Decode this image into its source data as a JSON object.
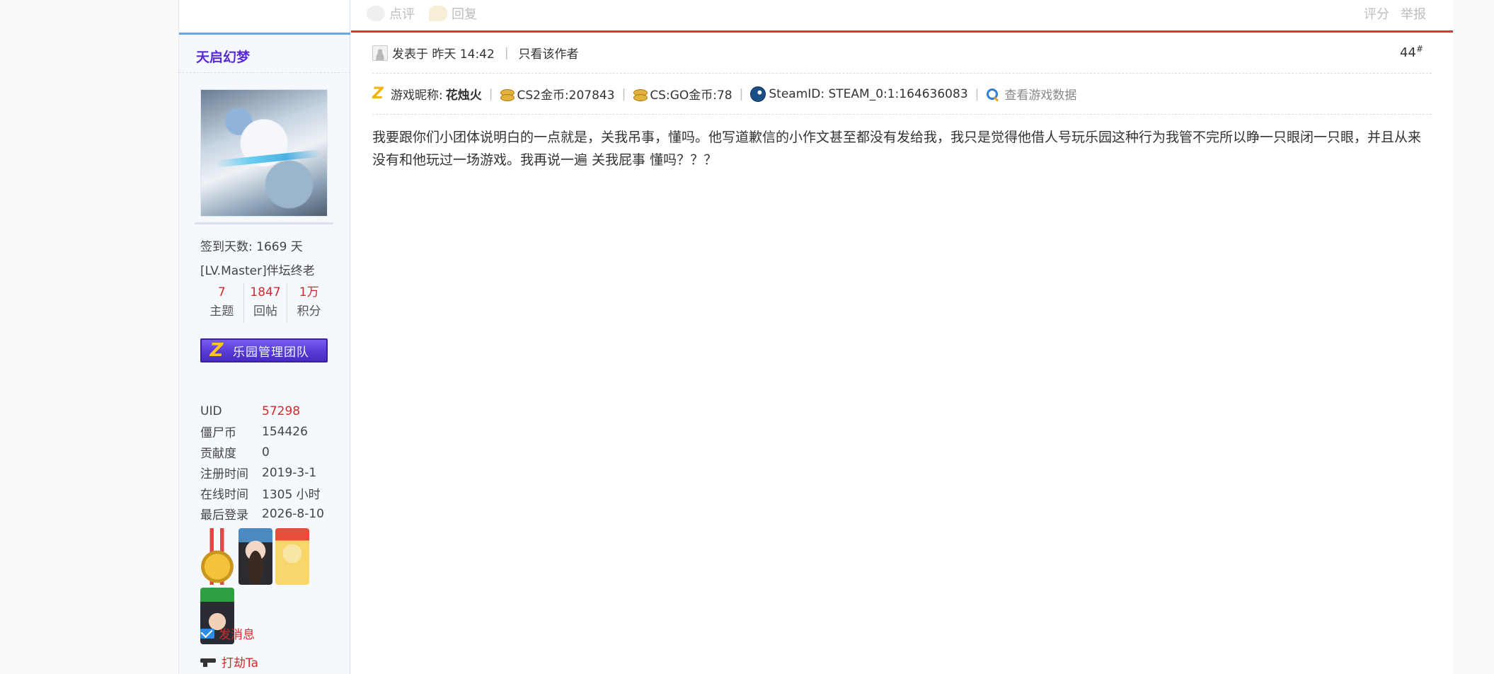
{
  "prev_post": {
    "comment_label": "点评",
    "reply_label": "回复",
    "rate_label": "评分",
    "report_label": "举报"
  },
  "author": {
    "name": "天启幻梦",
    "checkin": "签到天数: 1669 天",
    "level": "[LV.Master]伴坛终老",
    "stats": [
      {
        "num": "7",
        "label": "主题"
      },
      {
        "num": "1847",
        "label": "回帖"
      },
      {
        "num": "1万",
        "label": "积分"
      }
    ],
    "group_badge": "乐园管理团队",
    "info": [
      {
        "key": "UID",
        "value": "57298"
      },
      {
        "key": "僵尸币",
        "value": "154426"
      },
      {
        "key": "贡献度",
        "value": "0"
      },
      {
        "key": "注册时间",
        "value": "2019-3-1"
      },
      {
        "key": "在线时间",
        "value": "1305 小时"
      },
      {
        "key": "最后登录",
        "value": "2026-8-10"
      }
    ],
    "send_message": "发消息",
    "rob": "打劫Ta"
  },
  "post": {
    "posted_at": "发表于 昨天 14:42",
    "only_author": "只看该作者",
    "floor": "44",
    "floor_mark": "#",
    "game_nick_label": "游戏昵称:",
    "game_nick": "花烛火",
    "cs2_coin": "CS2金币:207843",
    "csgo_coin": "CS:GO金币:78",
    "steam_id": "SteamID: STEAM_0:1:164636083",
    "view_data": "查看游戏数据",
    "content": "我要跟你们小团体说明白的一点就是，关我吊事，懂吗。他写道歉信的小作文甚至都没有发给我，我只是觉得他借人号玩乐园这种行为我管不完所以睁一只眼闭一只眼，并且从来没有和他玩过一场游戏。我再说一遍 关我屁事 懂吗？？？"
  },
  "colors": {
    "accent_red": "#e03131",
    "author_name": "#5b2ad8",
    "stat_num": "#d12b2b",
    "badge_bg": "#5a3ad6"
  }
}
